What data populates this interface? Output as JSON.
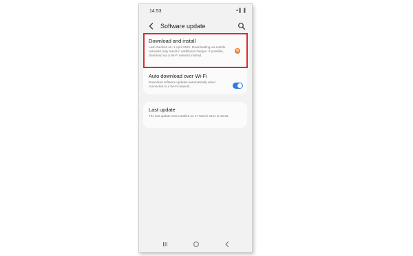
{
  "status_bar": {
    "time": "14:53",
    "icons": "⚭▌▐"
  },
  "app_bar": {
    "title": "Software update",
    "back_icon": "back-arrow-icon",
    "search_icon": "search-icon"
  },
  "download_install": {
    "title": "Download and install",
    "description": "Last checked on: 1 April 2021. Downloading via mobile networks may result in additional charges. If possible, download via a Wi-Fi network instead.",
    "badge": "N",
    "badge_color": "#f07b25",
    "highlight_color": "#e0282e"
  },
  "auto_download": {
    "title": "Auto download over Wi-Fi",
    "description": "Download software updates automatically when connected to a Wi-Fi network.",
    "toggle_on": true,
    "toggle_color": "#2f7ce0"
  },
  "last_update": {
    "title": "Last update",
    "description": "The last update was installed on 17 March 2021 at 15:22."
  },
  "nav_bar": {
    "recents_icon": "recents-icon",
    "home_icon": "home-icon",
    "back_icon": "nav-back-icon"
  }
}
